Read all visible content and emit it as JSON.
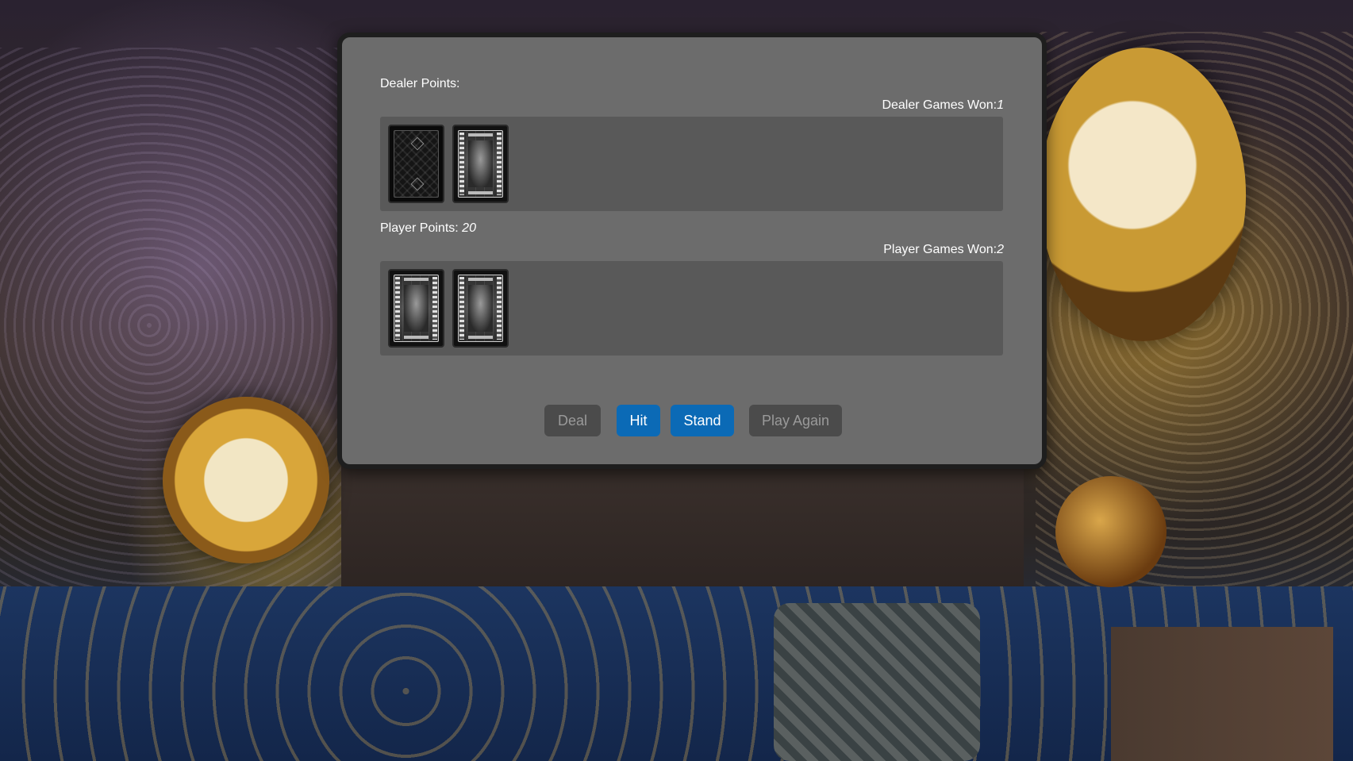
{
  "dealer": {
    "points_label": "Dealer Points:",
    "points_value": "",
    "games_won_label": "Dealer Games Won:",
    "games_won_value": "1",
    "cards": [
      "card-back",
      "card-face"
    ]
  },
  "player": {
    "points_label": "Player Points:",
    "points_value": "20",
    "games_won_label": "Player Games Won:",
    "games_won_value": "2",
    "cards": [
      "card-face",
      "card-face"
    ]
  },
  "controls": {
    "deal_label": "Deal",
    "hit_label": "Hit",
    "stand_label": "Stand",
    "play_again_label": "Play Again"
  },
  "colors": {
    "panel_bg": "#6c6c6c",
    "hand_bg": "#595959",
    "primary_button": "#0b6ab6",
    "disabled_button": "#4b4b4b"
  }
}
